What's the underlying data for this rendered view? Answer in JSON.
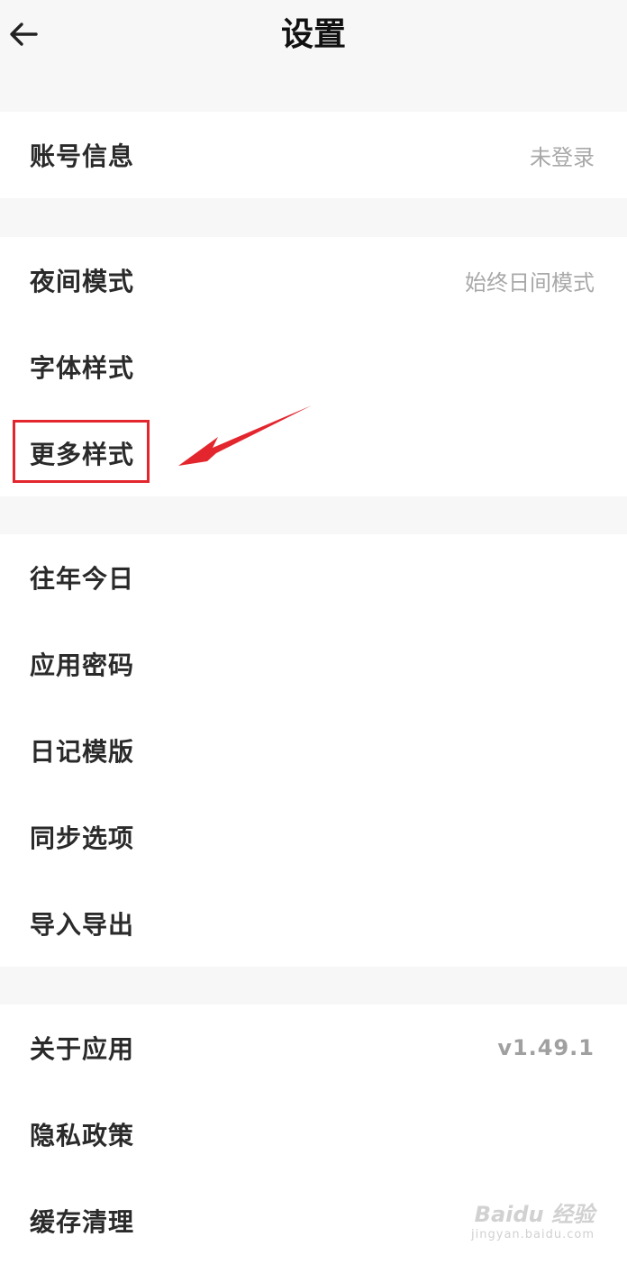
{
  "header": {
    "title": "设置"
  },
  "groups": [
    {
      "items": [
        {
          "label": "账号信息",
          "value": "未登录"
        }
      ]
    },
    {
      "items": [
        {
          "label": "夜间模式",
          "value": "始终日间模式"
        },
        {
          "label": "字体样式"
        },
        {
          "label": "更多样式"
        }
      ]
    },
    {
      "items": [
        {
          "label": "往年今日"
        },
        {
          "label": "应用密码"
        },
        {
          "label": "日记模版"
        },
        {
          "label": "同步选项"
        },
        {
          "label": "导入导出"
        }
      ]
    },
    {
      "items": [
        {
          "label": "关于应用",
          "value": "v1.49.1"
        },
        {
          "label": "隐私政策"
        },
        {
          "label": "缓存清理"
        }
      ]
    }
  ],
  "annotation": {
    "highlight_color": "#e3262d"
  },
  "watermark": {
    "main": "Baidu 经验",
    "sub": "jingyan.baidu.com"
  }
}
